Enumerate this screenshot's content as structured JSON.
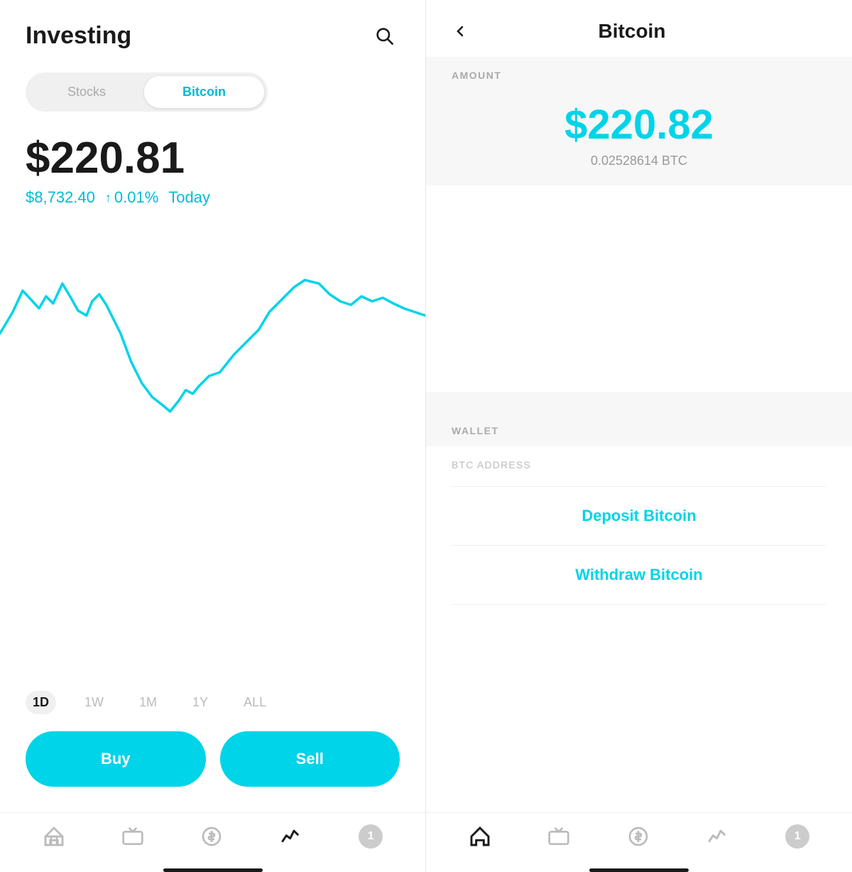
{
  "left": {
    "title": "Investing",
    "tabs": [
      {
        "label": "Stocks",
        "active": false
      },
      {
        "label": "Bitcoin",
        "active": true
      }
    ],
    "main_price": "$220.81",
    "btc_market_price": "$8,732.40",
    "change_arrow": "↑",
    "change_pct": "0.01%",
    "today_label": "Today",
    "time_ranges": [
      {
        "label": "1D",
        "active": true
      },
      {
        "label": "1W",
        "active": false
      },
      {
        "label": "1M",
        "active": false
      },
      {
        "label": "1Y",
        "active": false
      },
      {
        "label": "ALL",
        "active": false
      }
    ],
    "buy_label": "Buy",
    "sell_label": "Sell",
    "nav": {
      "items": [
        {
          "icon": "home",
          "active": false
        },
        {
          "icon": "tv",
          "active": false
        },
        {
          "icon": "dollar",
          "active": false
        },
        {
          "icon": "chart",
          "active": true
        },
        {
          "icon": "badge",
          "active": false,
          "count": "1"
        }
      ]
    }
  },
  "right": {
    "back_label": "<",
    "title": "Bitcoin",
    "amount_section_label": "AMOUNT",
    "amount_usd": "$220.82",
    "amount_btc": "0.02528614 BTC",
    "wallet_section_label": "WALLET",
    "btc_address_label": "BTC ADDRESS",
    "deposit_label": "Deposit Bitcoin",
    "withdraw_label": "Withdraw Bitcoin",
    "nav": {
      "items": [
        {
          "icon": "home",
          "active": true
        },
        {
          "icon": "tv",
          "active": false
        },
        {
          "icon": "dollar",
          "active": false
        },
        {
          "icon": "chart",
          "active": false
        },
        {
          "icon": "badge",
          "active": false,
          "count": "1"
        }
      ]
    }
  }
}
